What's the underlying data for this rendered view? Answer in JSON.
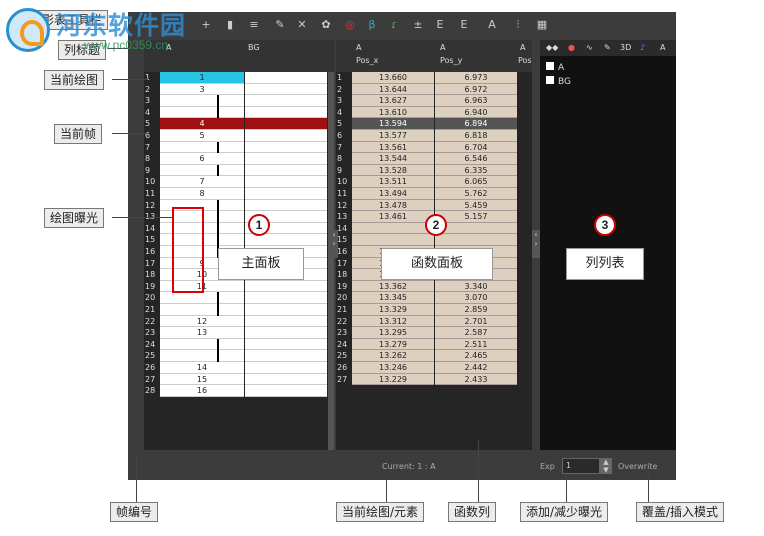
{
  "toolbar": {
    "label": "摄影表工具栏"
  },
  "main": {
    "header_col_a": "A",
    "header_col_b": "BG",
    "rows": [
      {
        "n": "1",
        "v": "1",
        "cur": true
      },
      {
        "n": "2",
        "v": "3"
      },
      {
        "n": "3",
        "v": "|"
      },
      {
        "n": "4",
        "v": "|"
      },
      {
        "n": "5",
        "v": "4",
        "sel": true
      },
      {
        "n": "6",
        "v": "5"
      },
      {
        "n": "7",
        "v": "|"
      },
      {
        "n": "8",
        "v": "6"
      },
      {
        "n": "9",
        "v": "|"
      },
      {
        "n": "10",
        "v": "7"
      },
      {
        "n": "11",
        "v": "8"
      },
      {
        "n": "12",
        "v": "|"
      },
      {
        "n": "13",
        "v": "|"
      },
      {
        "n": "14",
        "v": "|"
      },
      {
        "n": "15",
        "v": "|"
      },
      {
        "n": "16",
        "v": "|"
      },
      {
        "n": "17",
        "v": "9"
      },
      {
        "n": "18",
        "v": "10"
      },
      {
        "n": "19",
        "v": "11"
      },
      {
        "n": "20",
        "v": "|"
      },
      {
        "n": "21",
        "v": "|"
      },
      {
        "n": "22",
        "v": "12"
      },
      {
        "n": "23",
        "v": "13"
      },
      {
        "n": "24",
        "v": "|"
      },
      {
        "n": "25",
        "v": "|"
      },
      {
        "n": "26",
        "v": "14"
      },
      {
        "n": "27",
        "v": "15"
      },
      {
        "n": "28",
        "v": "16"
      }
    ]
  },
  "func": {
    "col_x_title": "A",
    "col_x_sub": "Pos_x",
    "col_y_title": "A",
    "col_y_sub": "Pos_y",
    "col_z_title": "A",
    "col_z_sub": "Pos",
    "rows": [
      [
        "1",
        "13.660",
        "6.973"
      ],
      [
        "2",
        "13.644",
        "6.972"
      ],
      [
        "3",
        "13.627",
        "6.963"
      ],
      [
        "4",
        "13.610",
        "6.940"
      ],
      [
        "5",
        "13.594",
        "6.894"
      ],
      [
        "6",
        "13.577",
        "6.818"
      ],
      [
        "7",
        "13.561",
        "6.704"
      ],
      [
        "8",
        "13.544",
        "6.546"
      ],
      [
        "9",
        "13.528",
        "6.335"
      ],
      [
        "10",
        "13.511",
        "6.065"
      ],
      [
        "11",
        "13.494",
        "5.762"
      ],
      [
        "12",
        "13.478",
        "5.459"
      ],
      [
        "13",
        "13.461",
        "5.157"
      ],
      [
        "14",
        "",
        ""
      ],
      [
        "15",
        "",
        ""
      ],
      [
        "16",
        "13.411",
        "4.248"
      ],
      [
        "17",
        "13.395",
        "3.946"
      ],
      [
        "18",
        "13.378",
        "3.643"
      ],
      [
        "19",
        "13.362",
        "3.340"
      ],
      [
        "20",
        "13.345",
        "3.070"
      ],
      [
        "21",
        "13.329",
        "2.859"
      ],
      [
        "22",
        "13.312",
        "2.701"
      ],
      [
        "23",
        "13.295",
        "2.587"
      ],
      [
        "24",
        "13.279",
        "2.511"
      ],
      [
        "25",
        "13.262",
        "2.465"
      ],
      [
        "26",
        "13.246",
        "2.442"
      ],
      [
        "27",
        "13.229",
        "2.433"
      ]
    ]
  },
  "list": {
    "items": [
      "A",
      "BG"
    ],
    "tab_3d": "3D",
    "tab_a": "A"
  },
  "status": {
    "current": "Current: 1 : A",
    "exp_label": "Exp",
    "exp_value": "1",
    "overwrite": "Overwrite"
  },
  "callouts": {
    "header": "列标题",
    "current_drawing": "当前绘图",
    "current_frame": "当前帧",
    "exposure": "绘图曝光",
    "frame_number": "帧编号",
    "current_element": "当前绘图/元素",
    "function_column": "函数列",
    "add_remove": "添加/减少曝光",
    "overwrite_insert": "覆盖/插入模式"
  },
  "panels": {
    "p1_num": "1",
    "p1": "主面板",
    "p2_num": "2",
    "p2": "函数面板",
    "p3_num": "3",
    "p3": "列列表"
  },
  "watermark": {
    "cn": "河东软件园",
    "url": "www.pc0359.cn"
  }
}
